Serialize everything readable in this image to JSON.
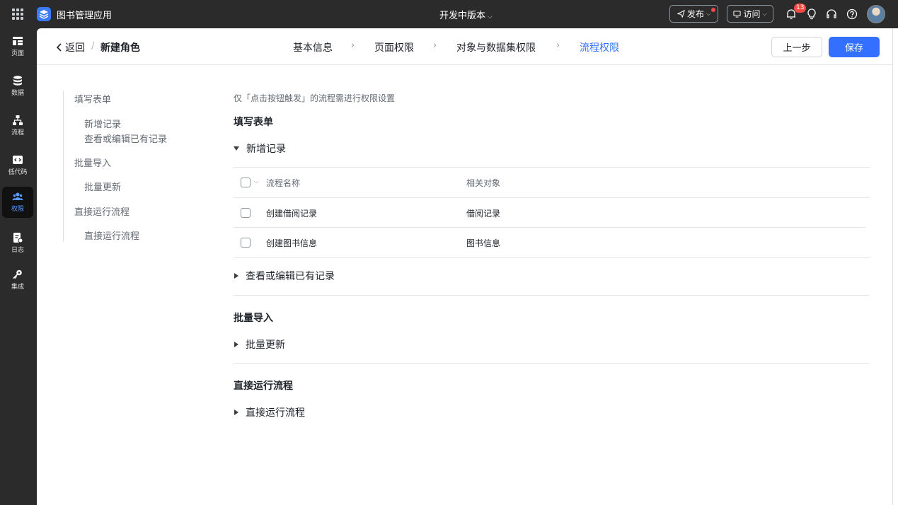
{
  "topbar": {
    "app_name": "图书管理应用",
    "version": "开发中版本",
    "publish_label": "发布",
    "visit_label": "访问",
    "notification_count": "13"
  },
  "nav": {
    "items": [
      {
        "label": "页面"
      },
      {
        "label": "数据"
      },
      {
        "label": "流程"
      },
      {
        "label": "低代码"
      },
      {
        "label": "权限"
      },
      {
        "label": "日志"
      },
      {
        "label": "集成"
      }
    ]
  },
  "header": {
    "back_label": "返回",
    "separator": "/",
    "title": "新建角色",
    "steps": [
      "基本信息",
      "页面权限",
      "对象与数据集权限",
      "流程权限"
    ],
    "prev_label": "上一步",
    "save_label": "保存"
  },
  "toc": {
    "items": [
      {
        "label": "填写表单"
      },
      {
        "label": "新增记录"
      },
      {
        "label": "查看或编辑已有记录"
      },
      {
        "label": "批量导入"
      },
      {
        "label": "批量更新"
      },
      {
        "label": "直接运行流程"
      },
      {
        "label": "直接运行流程"
      }
    ]
  },
  "content": {
    "notice": "仅「点击按钮触发」的流程需进行权限设置",
    "sections": [
      {
        "title": "填写表单"
      },
      {
        "title": "批量导入"
      },
      {
        "title": "直接运行流程"
      }
    ],
    "groups": [
      {
        "label": "新增记录"
      },
      {
        "label": "查看或编辑已有记录"
      },
      {
        "label": "批量更新"
      },
      {
        "label": "直接运行流程"
      }
    ],
    "table": {
      "columns": [
        "流程名称",
        "相关对象"
      ],
      "rows": [
        {
          "name": "创建借阅记录",
          "object": "借阅记录"
        },
        {
          "name": "创建图书信息",
          "object": "图书信息"
        }
      ]
    }
  }
}
